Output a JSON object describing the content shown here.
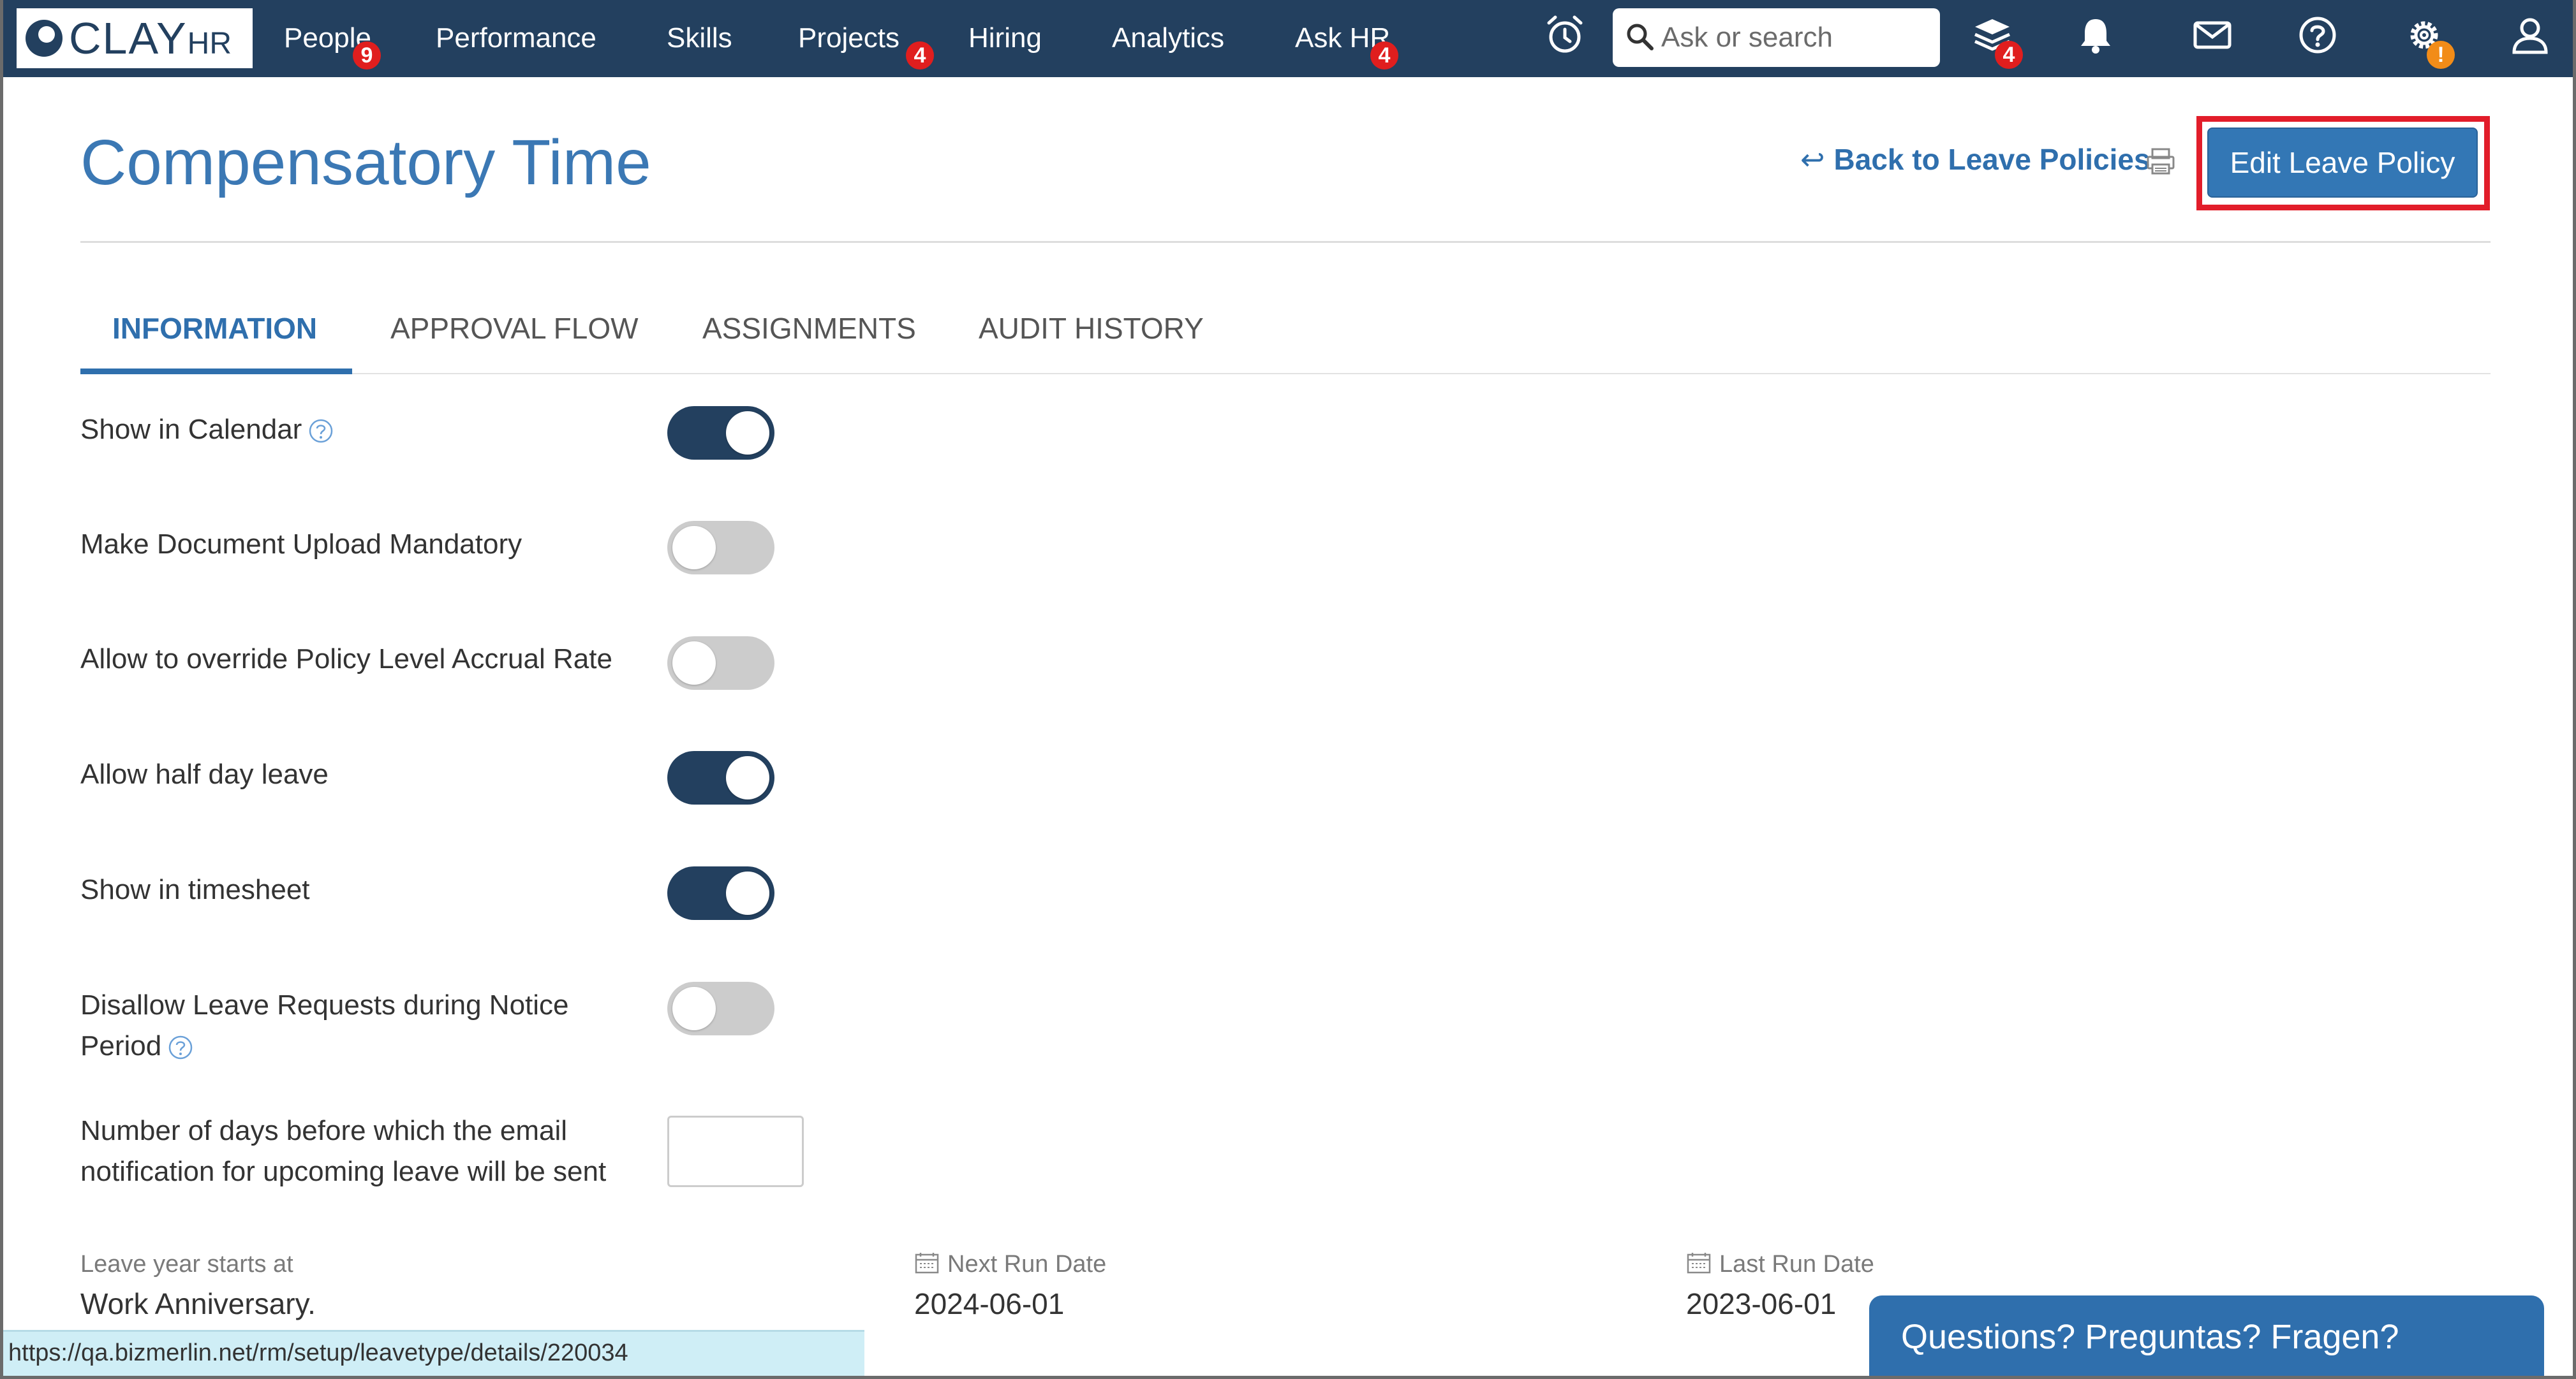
{
  "brand": {
    "logo_text": "CLAY",
    "logo_suffix": "HR",
    "primary_color": "#23405f",
    "accent_color": "#3377b5",
    "highlight_color": "#e21d2a"
  },
  "nav": {
    "items": [
      {
        "label": "People",
        "badge": "9"
      },
      {
        "label": "Performance"
      },
      {
        "label": "Skills"
      },
      {
        "label": "Projects",
        "badge": "4"
      },
      {
        "label": "Hiring"
      },
      {
        "label": "Analytics"
      },
      {
        "label": "Ask HR",
        "badge": "4"
      }
    ],
    "search_placeholder": "Ask or search",
    "icons": [
      "alarm-clock-icon",
      "search-icon",
      "layers-icon",
      "bell-icon",
      "mail-icon",
      "help-icon",
      "gear-icon",
      "user-icon"
    ],
    "layers_badge": "4",
    "settings_badge": "!"
  },
  "header": {
    "title": "Compensatory Time",
    "back_link": "Back to Leave Policies",
    "edit_button": "Edit Leave Policy"
  },
  "tabs": [
    {
      "label": "INFORMATION",
      "active": true
    },
    {
      "label": "APPROVAL FLOW",
      "active": false
    },
    {
      "label": "ASSIGNMENTS",
      "active": false
    },
    {
      "label": "AUDIT HISTORY",
      "active": false
    }
  ],
  "settings": [
    {
      "label": "Show in Calendar",
      "enabled": true,
      "has_help": true
    },
    {
      "label": "Make Document Upload Mandatory",
      "enabled": false
    },
    {
      "label": "Allow to override Policy Level Accrual Rate",
      "enabled": false
    },
    {
      "label": "Allow half day leave",
      "enabled": true
    },
    {
      "label": "Show in timesheet",
      "enabled": true
    },
    {
      "label": "Disallow Leave Requests during Notice Period",
      "enabled": false,
      "has_help": true
    }
  ],
  "notification_days": {
    "label": "Number of days before which the email notification for upcoming leave will be sent",
    "value": ""
  },
  "info": {
    "leave_year_label": "Leave year starts at",
    "leave_year_value": "Work Anniversary.",
    "next_run_label": "Next Run Date",
    "next_run_value": "2024-06-01",
    "last_run_label": "Last Run Date",
    "last_run_value": "2023-06-01"
  },
  "status_bar_url": "https://qa.bizmerlin.net/rm/setup/leavetype/details/220034",
  "chat_widget_label": "Questions? Preguntas? Fragen?"
}
